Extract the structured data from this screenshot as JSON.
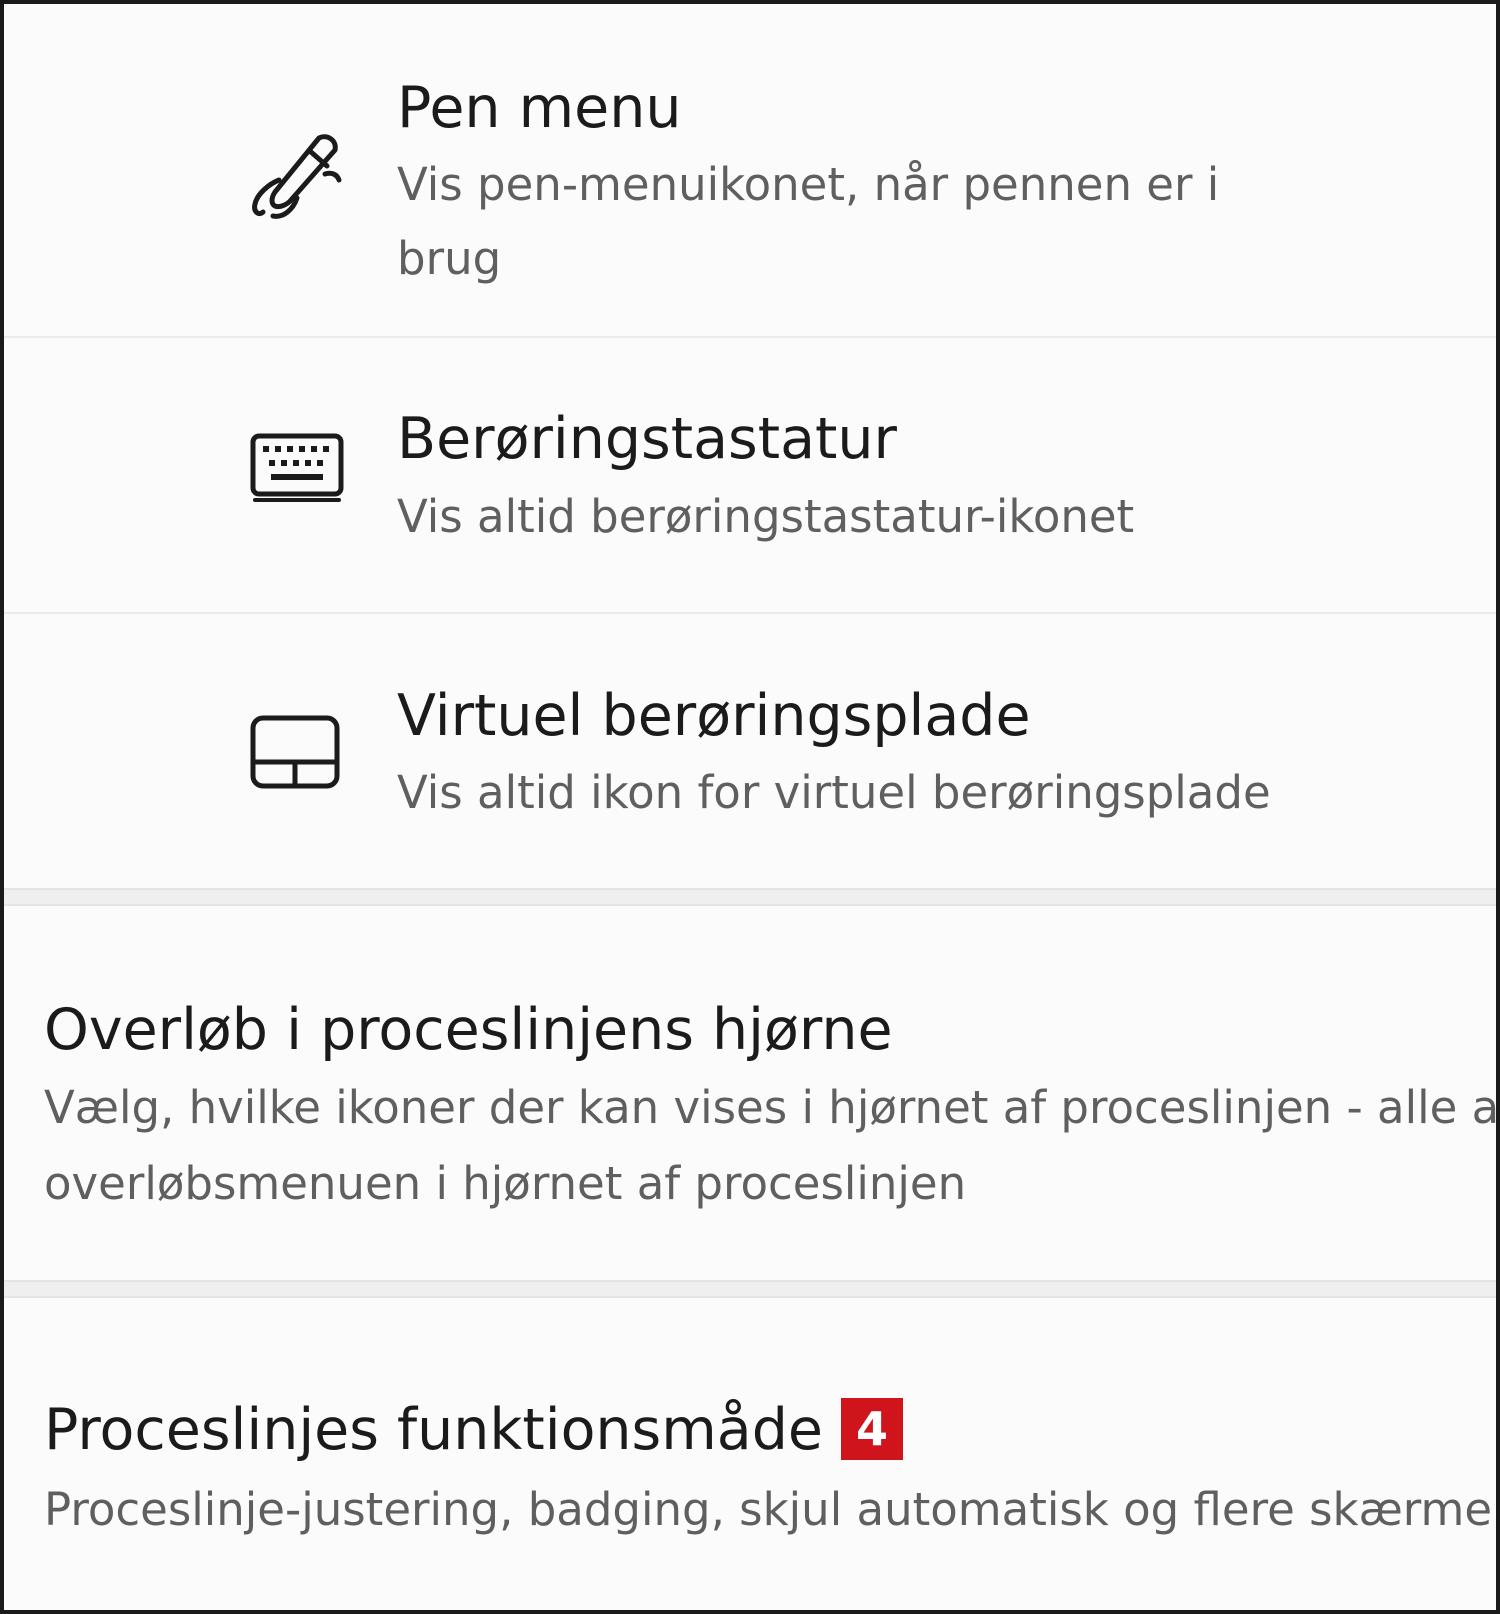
{
  "items": [
    {
      "title": "Pen menu",
      "description": "Vis pen-menuikonet, når pennen er i brug",
      "icon": "pen-icon"
    },
    {
      "title": "Berøringstastatur",
      "description": "Vis altid berøringstastatur-ikonet",
      "icon": "keyboard-icon"
    },
    {
      "title": "Virtuel berøringsplade",
      "description": "Vis altid ikon for virtuel berøringsplade",
      "icon": "touchpad-icon"
    }
  ],
  "overflow_section": {
    "title": "Overløb i proceslinjens hjørne",
    "description_line1": "Vælg, hvilke ikoner der kan vises i hjørnet af proceslinjen - alle andre vises i",
    "description_line2": "overløbsmenuen i hjørnet af proceslinjen"
  },
  "behavior_section": {
    "title": "Proceslinjes funktionsmåde",
    "badge": "4",
    "description": "Proceslinje-justering, badging, skjul automatisk og flere skærme"
  },
  "colors": {
    "badge": "#d0141c",
    "background": "#fbfbfb",
    "title_text": "#1b1b1b",
    "description_text": "#5f5f5f"
  }
}
